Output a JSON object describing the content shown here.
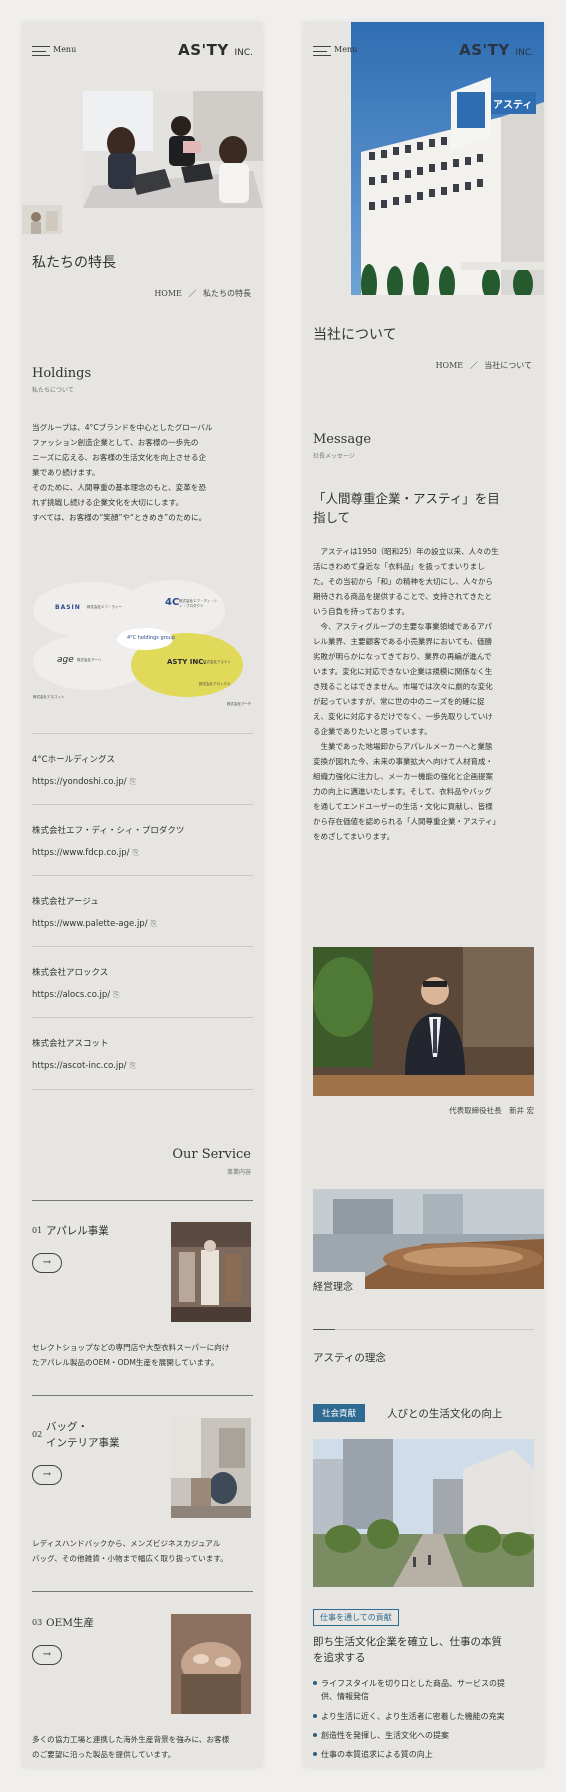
{
  "left": {
    "header": {
      "menu_label": "Menu",
      "logo_text": "AS'TY",
      "logo_suffix": "INC."
    },
    "page_title": "私たちの特長",
    "breadcrumb": {
      "home": "HOME",
      "sep": "／",
      "current": "私たちの特長"
    },
    "holdings": {
      "title": "Holdings",
      "subtitle": "私たちについて",
      "lines": [
        "当グループは、4°Cブランドを中心としたグローバル",
        "ファッション創造企業として、お客様の一歩先の",
        "ニーズに応える、お客様の生活文化を向上させる企",
        "業であり続けます。",
        "そのために、人間尊重の基本理念のもと、変革を恐",
        "れず挑戦し続ける企業文化を大切にします。",
        "すべては、お客様の“笑顔”や“ときめき”のために。"
      ]
    },
    "diagram": {
      "center": "4°C holdings group",
      "nodes": [
        {
          "label": "BASIN"
        },
        {
          "label": "株式会社アスティ"
        },
        {
          "label": "株式会社アーチ"
        }
      ],
      "small_labels": [
        "株式会社エフ・ディー",
        "株式会社エフ・ディ・シィ・プロダクツ",
        "4C",
        "age",
        "株式会社アーリ",
        "ASTY INC.",
        "株式会社アロックス",
        "株式会社アスコット"
      ]
    },
    "companies": [
      {
        "name": "4°Cホールディングス",
        "url": "https://yondoshi.co.jp/"
      },
      {
        "name": "株式会社エフ・ディ・シィ・プロダクツ",
        "url": "https://www.fdcp.co.jp/"
      },
      {
        "name": "株式会社アージュ",
        "url": "https://www.palette-age.jp/"
      },
      {
        "name": "株式会社アロックス",
        "url": "https://alocs.co.jp/"
      },
      {
        "name": "株式会社アスコット",
        "url": "https://ascot-inc.co.jp/"
      }
    ],
    "ext_icon": "⎘",
    "service": {
      "title": "Our Service",
      "subtitle": "事業内容",
      "items": [
        {
          "num": "01",
          "title_lines": [
            "アパレル事業"
          ],
          "desc_lines": [
            "セレクトショップなどの専門店や大型衣料スーパーに向け",
            "たアパレル製品のOEM・ODM生産を展開しています。"
          ]
        },
        {
          "num": "02",
          "title_lines": [
            "バッグ・",
            "インテリア事業"
          ],
          "desc_lines": [
            "レディスハンドバックから、メンズビジネスカジュアル",
            "バッグ、その他雑貨・小物まで幅広く取り扱っています。"
          ]
        },
        {
          "num": "03",
          "title_lines": [
            "OEM生産"
          ],
          "desc_lines": [
            "多くの協力工場と連携した海外生産背景を強みに、お客様",
            "のご要望に沿った製品を提供しています。"
          ]
        }
      ]
    },
    "arrow": "→"
  },
  "right": {
    "header": {
      "menu_label": "Menu",
      "logo_text": "AS'TY",
      "logo_suffix": "INC."
    },
    "sign_text": "アスティ",
    "page_title": "当社について",
    "breadcrumb": {
      "home": "HOME",
      "sep": "／",
      "current": "当社について"
    },
    "message": {
      "title": "Message",
      "subtitle": "社長メッセージ",
      "headline_lines": [
        "「人間尊重企業・アスティ」を目",
        "指して"
      ],
      "lines": [
        "　アスティは1950（昭和25）年の設立以来、人々の生",
        "活にきわめて身近な「衣料品」を扱ってまいりまし",
        "た。その当初から「和」の精神を大切にし、人々から",
        "期待される商品を提供することで、支持されてきたと",
        "いう自負を持っております。",
        "　今、アスティグループの主要な事業領域であるアパ",
        "レル業界、主要顧客である小売業界においても、価勝",
        "劣敗が明らかになってきており、業界の再編が進んで",
        "います。変化に対応できない企業は規模に関係なく生",
        "き残ることはできません。市場では次々に劇的な変化",
        "が起っていますが、常に世の中のニーズを的確に捉",
        "え、変化に対応するだけでなく、一歩先取りしていけ",
        "る企業でありたいと思っています。",
        "　生業であった地場卸からアパレルメーカーへと業態",
        "変換が図れた今、未来の事業拡大へ向けて人材育成・",
        "組織力強化に注力し、メーカー機能の強化と企画提案",
        "力の向上に邁進いたします。そして、衣料品やバッグ",
        "を通してエンドユーザーの生活・文化に貢献し、皆様",
        "から存在価値を認められる「人間尊重企業・アスティ」",
        "をめざしてまいります。"
      ],
      "caption": "代表取締役社長　新井 宏"
    },
    "philosophy": {
      "label": "経営理念",
      "title": "アスティの理念",
      "tag": "社会貢献",
      "tag_title": "人びとの生活文化の向上",
      "outline_tag": "仕事を通しての貢献",
      "heading_lines": [
        "即ち生活文化企業を確立し、仕事の本質",
        "を追求する"
      ],
      "bullets": [
        [
          "ライフスタイルを切り口とした商品、サービスの提",
          "供、情報発信"
        ],
        [
          "より生活に近く、より生活者に密着した機能の充実"
        ],
        [
          "創造性を発揮し、生活文化への提案"
        ],
        [
          "仕事の本質追求による質の向上"
        ]
      ]
    }
  },
  "colors": {
    "accent_blue": "#2f6a93",
    "diagram_yellow": "#e0d95a",
    "page_bg": "#e6e5e1"
  }
}
